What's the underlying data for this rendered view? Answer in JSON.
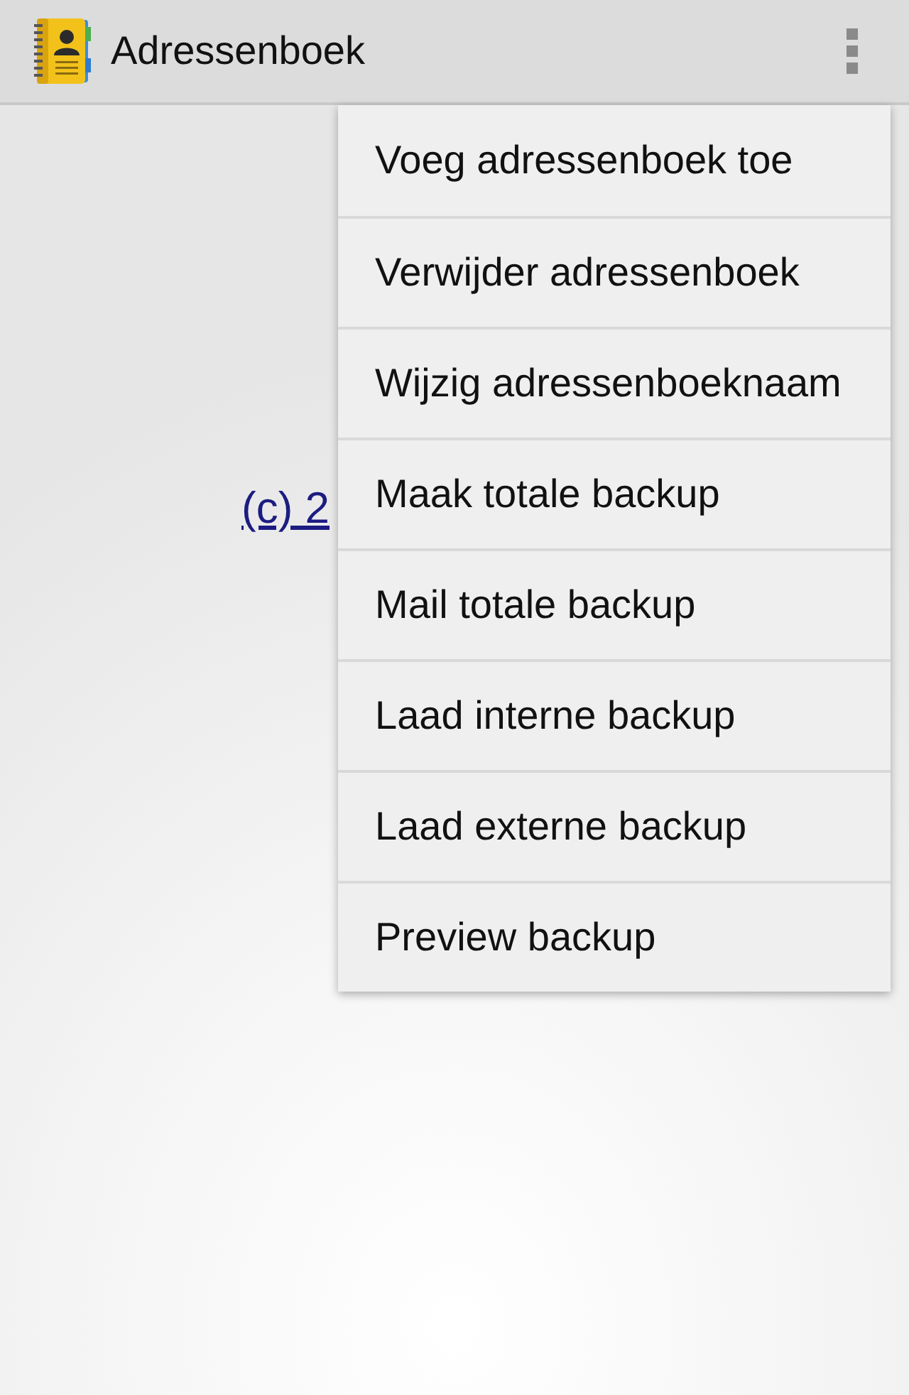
{
  "action_bar": {
    "title": "Adressenboek"
  },
  "content": {
    "link": "(c) 2"
  },
  "overflow_menu": {
    "items": [
      {
        "label": "Voeg adressenboek toe"
      },
      {
        "label": "Verwijder adressenboek"
      },
      {
        "label": "Wijzig adressenboeknaam"
      },
      {
        "label": "Maak totale backup"
      },
      {
        "label": "Mail totale backup"
      },
      {
        "label": "Laad interne backup"
      },
      {
        "label": "Laad externe backup"
      },
      {
        "label": "Preview backup"
      }
    ]
  }
}
